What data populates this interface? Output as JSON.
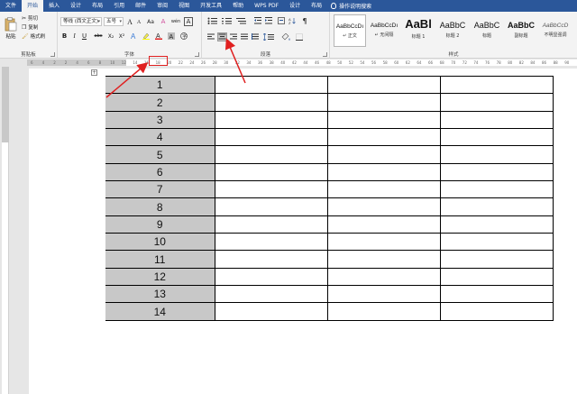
{
  "tabs": [
    {
      "label": "文件"
    },
    {
      "label": "开始"
    },
    {
      "label": "插入"
    },
    {
      "label": "设计"
    },
    {
      "label": "布局"
    },
    {
      "label": "引用"
    },
    {
      "label": "邮件"
    },
    {
      "label": "审阅"
    },
    {
      "label": "视图"
    },
    {
      "label": "开发工具"
    },
    {
      "label": "帮助"
    },
    {
      "label": "WPS PDF"
    },
    {
      "label": "设计"
    },
    {
      "label": "布局"
    }
  ],
  "tell_me": "操作说明搜索",
  "clipboard": {
    "paste": "粘贴",
    "cut": "剪切",
    "copy": "复制",
    "format_painter": "格式刷",
    "label": "剪贴板"
  },
  "font": {
    "family": "等线 (西文正文)",
    "size": "五号",
    "label": "字体",
    "bold": "B",
    "italic": "I",
    "underline": "U",
    "strike": "abc",
    "sub": "X₂",
    "sup": "X²",
    "grow": "A",
    "shrink": "A",
    "case": "Aa",
    "clear": "A",
    "phonetic": "wén",
    "border_char": "A"
  },
  "paragraph": {
    "label": "段落"
  },
  "styles": {
    "label": "样式",
    "items": [
      {
        "preview": "AaBbCcDı",
        "name": "↵ 正文"
      },
      {
        "preview": "AaBbCcDı",
        "name": "↵ 无间隔"
      },
      {
        "preview": "AaBl",
        "name": "标题 1"
      },
      {
        "preview": "AaBbC",
        "name": "标题 2"
      },
      {
        "preview": "AaBbC",
        "name": "标题"
      },
      {
        "preview": "AaBbC",
        "name": "副标题"
      },
      {
        "preview": "AaBbCcD",
        "name": "不明显强调"
      }
    ]
  },
  "ruler_numbers": [
    "6",
    "4",
    "2",
    "2",
    "4",
    "6",
    "8",
    "10",
    "12",
    "14",
    "16",
    "18",
    "20",
    "22",
    "24",
    "26",
    "28",
    "30",
    "32",
    "34",
    "36",
    "38",
    "40",
    "42",
    "44",
    "46",
    "48",
    "50",
    "52",
    "54",
    "56",
    "58",
    "60",
    "62",
    "64",
    "66",
    "68",
    "70",
    "72",
    "74",
    "76",
    "78",
    "80",
    "82",
    "84",
    "86",
    "88",
    "90"
  ],
  "table_rows": [
    {
      "n": "1"
    },
    {
      "n": "2"
    },
    {
      "n": "3"
    },
    {
      "n": "4"
    },
    {
      "n": "5"
    },
    {
      "n": "6"
    },
    {
      "n": "7"
    },
    {
      "n": "8"
    },
    {
      "n": "9"
    },
    {
      "n": "10"
    },
    {
      "n": "11"
    },
    {
      "n": "12"
    },
    {
      "n": "13"
    },
    {
      "n": "14"
    }
  ],
  "colors": {
    "accent": "#2b579a",
    "annotation": "#e02020",
    "cell_fill": "#c8c8c8"
  }
}
